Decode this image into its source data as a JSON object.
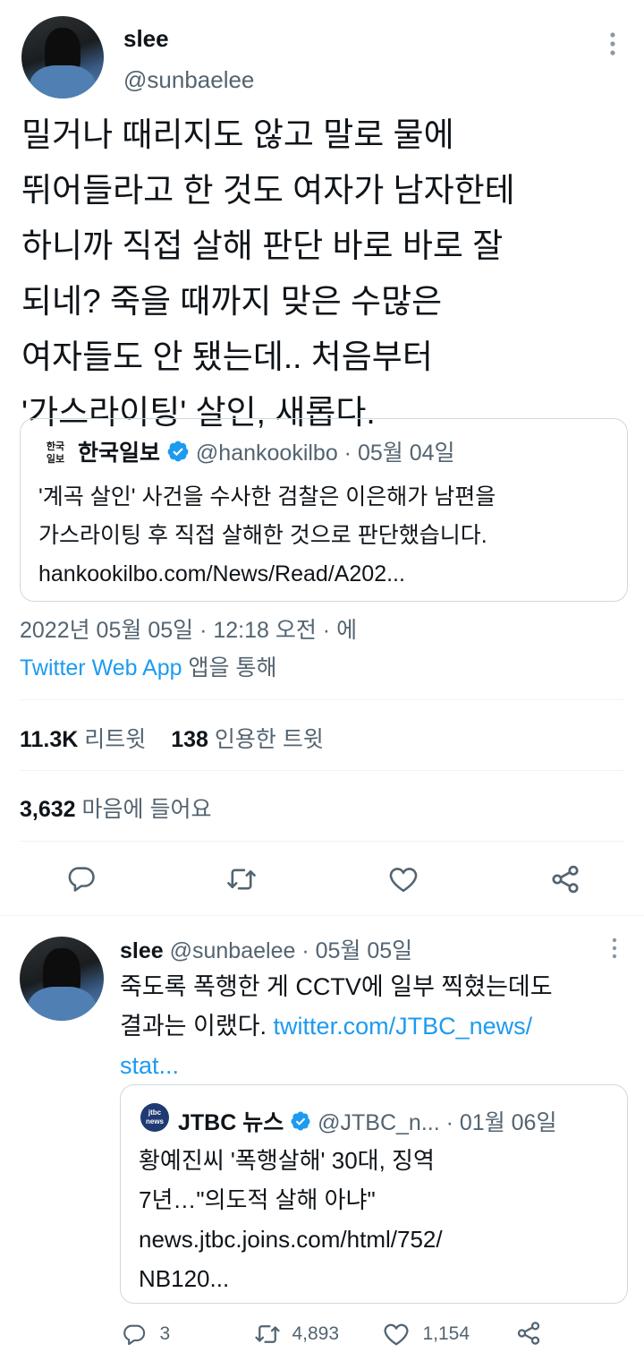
{
  "main_tweet": {
    "display_name": "slee",
    "handle": "@sunbaelee",
    "text_lines": [
      "밀거나 때리지도 않고 말로 물에",
      "뛰어들라고 한 것도 여자가 남자한테",
      "하니까 직접 살해 판단 바로 바로 잘",
      "되네? 죽을 때까지 맞은 수많은",
      "여자들도 안 됐는데.. 처음부터",
      "'가스라이팅' 살인, 새롭다."
    ],
    "quote": {
      "logo_text": "한국\n일보",
      "name": "한국일보",
      "handle_date": "@hankookilbo · 05월 04일",
      "lines": [
        "'계곡 살인' 사건을 수사한 검찰은 이은해가 남편을",
        "가스라이팅 후 직접 살해한 것으로 판단했습니다.",
        "hankookilbo.com/News/Read/A202..."
      ]
    },
    "timestamp": "2022년 05월 05일 · 12:18 오전 · 에",
    "source_link": "Twitter Web App",
    "source_suffix": " 앱을 통해",
    "stats": {
      "retweets_count": "11.3K",
      "retweets_label": " 리트윗",
      "quotes_count": "138",
      "quotes_label": " 인용한 트윗",
      "likes_count": "3,632",
      "likes_label": " 마음에 들어요"
    }
  },
  "reply_tweet": {
    "display_name": "slee",
    "meta": "@sunbaelee · 05월 05일",
    "line1": "죽도록 폭행한 게 CCTV에 일부 찍혔는데도",
    "line2_text": "결과는 이랬다. ",
    "line2_link": "twitter.com/JTBC_news/",
    "line3_link": "stat...",
    "quote": {
      "logo_text": "jtbc\nnews",
      "name": "JTBC 뉴스",
      "handle_date": "@JTBC_n... · 01월 06일",
      "lines": [
        "황예진씨 '폭행살해' 30대, 징역",
        "7년…\"의도적 살해 아냐\"",
        "news.jtbc.joins.com/html/752/",
        "NB120..."
      ]
    },
    "actions": {
      "replies": "3",
      "retweets": "4,893",
      "likes": "1,154"
    }
  },
  "colors": {
    "text": "#0f1419",
    "muted": "#536471",
    "link": "#1d9bf0",
    "border": "#cfd9de",
    "divider": "#eff3f4"
  },
  "icons": [
    "more-icon",
    "verified-icon",
    "reply-icon",
    "retweet-icon",
    "like-icon",
    "share-icon"
  ]
}
